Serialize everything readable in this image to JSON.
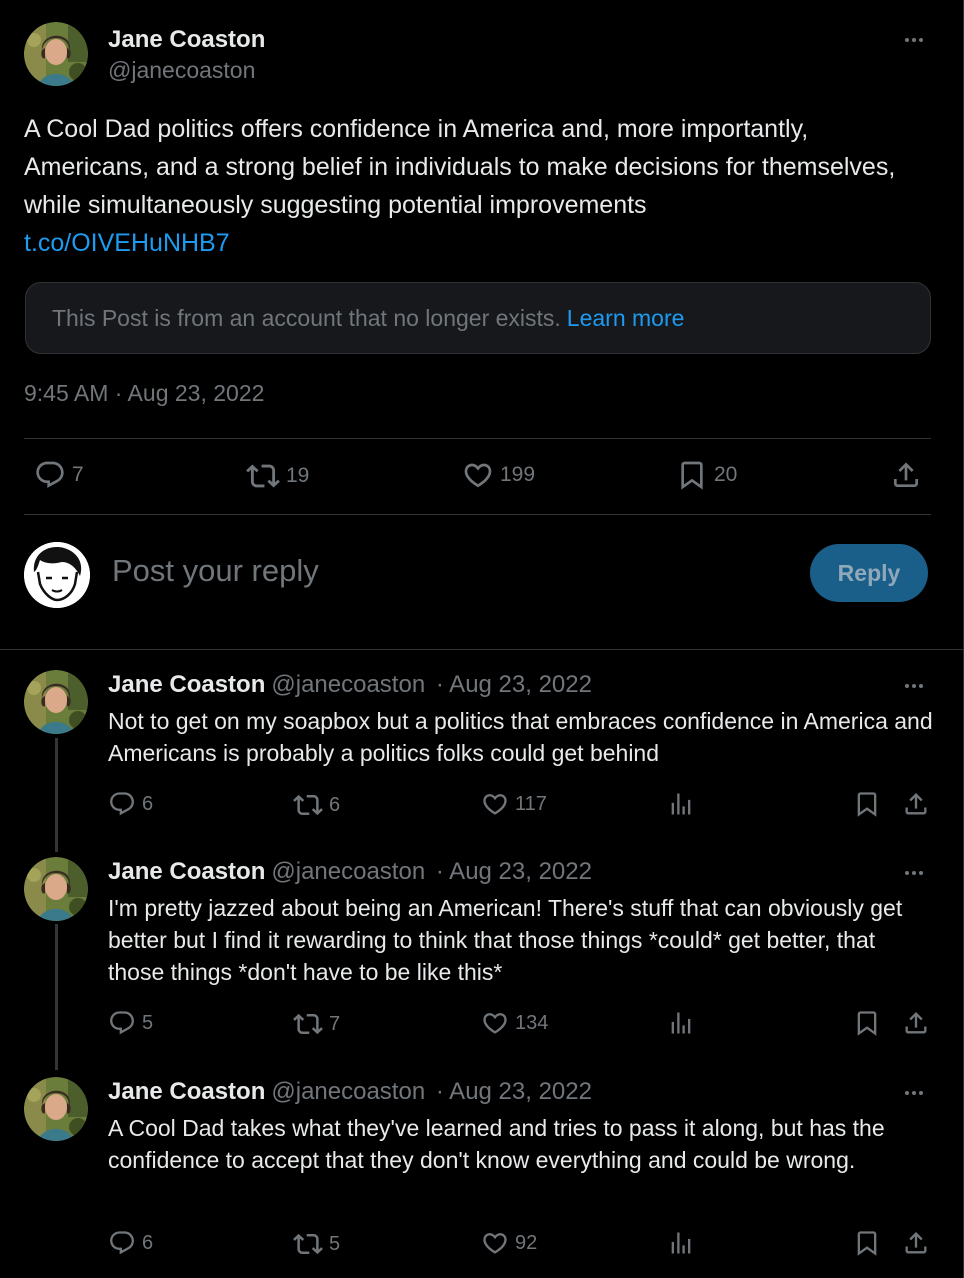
{
  "main_tweet": {
    "author_name": "Jane Coaston",
    "author_handle": "@janecoaston",
    "text": "A Cool Dad politics offers confidence in America and, more importantly, Americans, and a strong belief in individuals to make decisions for themselves, while simultaneously suggesting potential improvements",
    "link": "t.co/OIVEHuNHB7",
    "notice_text": "This Post is from an account that no longer exists.",
    "notice_link": "Learn more",
    "timestamp": "9:45 AM · Aug 23, 2022",
    "stats": {
      "replies": "7",
      "reposts": "19",
      "likes": "199",
      "bookmarks": "20"
    }
  },
  "reply_box": {
    "placeholder": "Post your reply",
    "button_label": "Reply"
  },
  "thread": [
    {
      "author_name": "Jane Coaston",
      "author_handle": "@janecoaston",
      "date": "· Aug 23, 2022",
      "text": "Not to get on my soapbox but a politics that embraces confidence in America and Americans is probably a politics folks could get behind",
      "replies": "6",
      "reposts": "6",
      "likes": "117"
    },
    {
      "author_name": "Jane Coaston",
      "author_handle": "@janecoaston",
      "date": "· Aug 23, 2022",
      "text": "I'm pretty jazzed about being an American! There's stuff that can obviously get better but I find it rewarding to think that those things *could* get better, that those things *don't have to be like this*",
      "replies": "5",
      "reposts": "7",
      "likes": "134"
    },
    {
      "author_name": "Jane Coaston",
      "author_handle": "@janecoaston",
      "date": "· Aug 23, 2022",
      "text": "A Cool Dad takes what they've learned and tries to pass it along, but has the confidence to accept that they don't know everything and could be wrong.",
      "replies": "6",
      "reposts": "5",
      "likes": "92"
    }
  ],
  "colors": {
    "background": "#000000",
    "text": "#e7e9ea",
    "muted": "#71767b",
    "accent": "#1d9bf0",
    "border": "#2f3336",
    "reply_button_bg": "#1a5e8a"
  }
}
